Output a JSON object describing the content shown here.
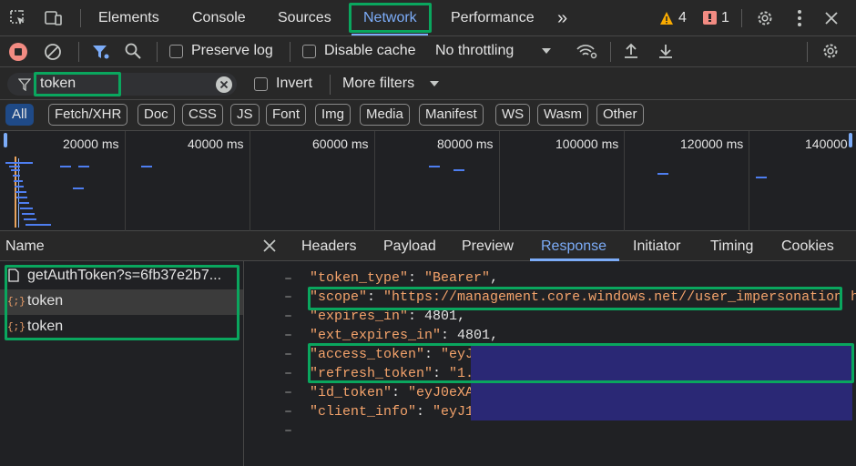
{
  "tabs": [
    "Elements",
    "Console",
    "Sources",
    "Network",
    "Performance"
  ],
  "more_tabs": "»",
  "warnings_count": "4",
  "errors_count": "1",
  "toolbar": {
    "preserve_log": "Preserve log",
    "disable_cache": "Disable cache",
    "throttling": "No throttling"
  },
  "filter": {
    "value": "token",
    "invert": "Invert",
    "more_filters": "More filters"
  },
  "chips": [
    "All",
    "Fetch/XHR",
    "Doc",
    "CSS",
    "JS",
    "Font",
    "Img",
    "Media",
    "Manifest",
    "WS",
    "Wasm",
    "Other"
  ],
  "timeline_ticks": [
    "20000 ms",
    "40000 ms",
    "60000 ms",
    "80000 ms",
    "100000 ms",
    "120000 ms",
    "140000"
  ],
  "requests": {
    "header": "Name",
    "items": [
      "getAuthToken?s=6fb37e2b7...",
      "token",
      "token"
    ]
  },
  "detail_tabs": [
    "Headers",
    "Payload",
    "Preview",
    "Response",
    "Initiator",
    "Timing",
    "Cookies"
  ],
  "response": {
    "l1k": "\"token_type\"",
    "l1v": "\"Bearer\"",
    "l2k": "\"scope\"",
    "l2v": "\"https://management.core.windows.net//user_impersonation h",
    "l3k": "\"expires_in\"",
    "l3v": "4801",
    "l4k": "\"ext_expires_in\"",
    "l4v": "4801",
    "l5k": "\"access_token\"",
    "l5v": "\"eyJ",
    "l6k": "\"refresh_token\"",
    "l6v": "\"1.",
    "l7k": "\"id_token\"",
    "l7v": "\"eyJ0eXA",
    "l8k": "\"client_info\"",
    "l8v": "\"eyJ1"
  },
  "colors": {
    "accent": "#7cacf8",
    "highlight": "#0aa65e",
    "redact": "#2a2875"
  }
}
